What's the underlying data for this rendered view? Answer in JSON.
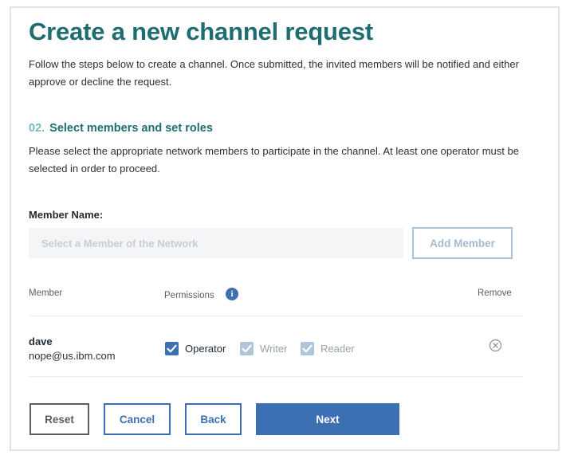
{
  "page": {
    "title": "Create a new channel request",
    "intro": "Follow the steps below to create a channel. Once submitted, the invited members will be notified and either approve or decline the request."
  },
  "step": {
    "number": "02.",
    "title": "Select members and set roles",
    "description": "Please select the appropriate network members to participate in the channel. At least one operator must be selected in order to proceed."
  },
  "member_form": {
    "label": "Member Name:",
    "placeholder": "Select a Member of the Network",
    "value": "",
    "add_button": "Add Member"
  },
  "table": {
    "headers": {
      "member": "Member",
      "permissions": "Permissions",
      "remove": "Remove"
    },
    "info_icon": "info-icon",
    "rows": [
      {
        "name": "dave",
        "email": "nope@us.ibm.com",
        "permissions": [
          {
            "label": "Operator",
            "checked": true,
            "enabled": true
          },
          {
            "label": "Writer",
            "checked": true,
            "enabled": false
          },
          {
            "label": "Reader",
            "checked": true,
            "enabled": false
          }
        ],
        "remove_icon": "close-circle-icon"
      }
    ]
  },
  "buttons": {
    "reset": "Reset",
    "cancel": "Cancel",
    "back": "Back",
    "next": "Next"
  },
  "colors": {
    "heading": "#1e6d71",
    "step_number": "#7db7bf",
    "primary": "#3d70b2",
    "disabled_checkbox": "#b0c4dc",
    "add_button_border": "#aac3de"
  }
}
